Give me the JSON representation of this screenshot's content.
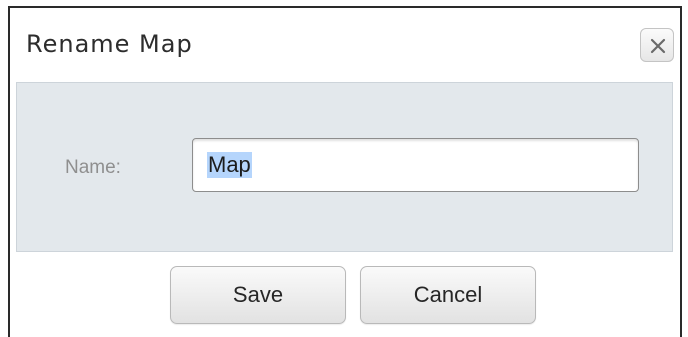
{
  "dialog": {
    "title": "Rename Map",
    "close_icon": "close-icon",
    "name_label": "Name:",
    "name_value": "Map",
    "buttons": {
      "save_label": "Save",
      "cancel_label": "Cancel"
    }
  },
  "colors": {
    "content_background": "#e3e8ec",
    "selection_highlight": "#b5d5fc",
    "label_text": "#8f8f8f"
  }
}
